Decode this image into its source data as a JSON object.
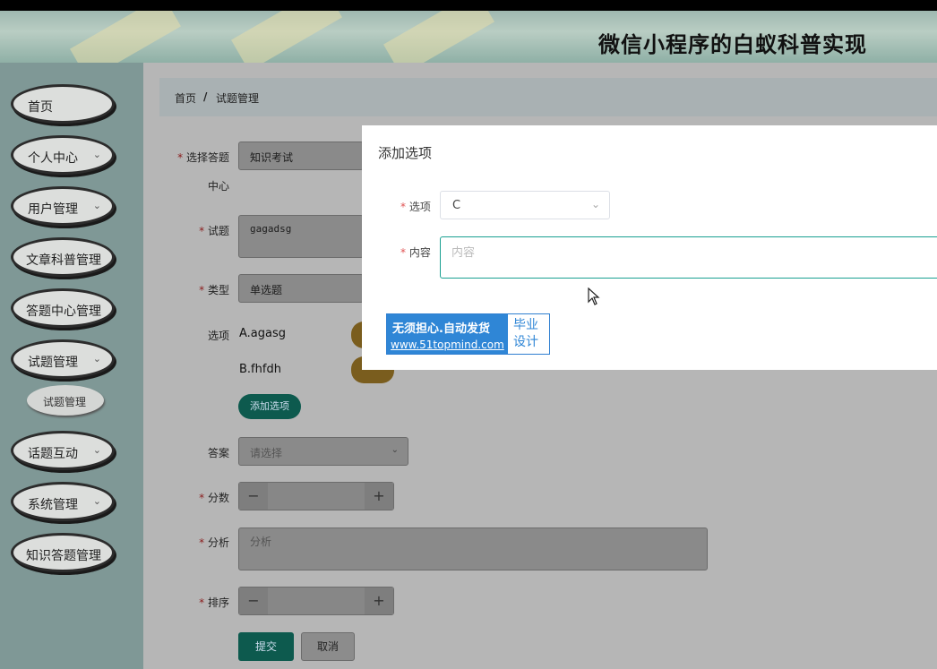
{
  "app_title": "微信小程序的白蚁科普实现",
  "sidebar": {
    "items": [
      {
        "label": "首页",
        "has_chevron": false
      },
      {
        "label": "个人中心",
        "has_chevron": true
      },
      {
        "label": "用户管理",
        "has_chevron": true
      },
      {
        "label": "文章科普管理",
        "has_chevron": false
      },
      {
        "label": "答题中心管理",
        "has_chevron": false
      },
      {
        "label": "试题管理",
        "has_chevron": true
      },
      {
        "label": "话题互动",
        "has_chevron": true
      },
      {
        "label": "系统管理",
        "has_chevron": true
      },
      {
        "label": "知识答题管理",
        "has_chevron": false
      }
    ],
    "sub_item": "试题管理"
  },
  "breadcrumb": {
    "home": "首页",
    "separator": "/",
    "current": "试题管理"
  },
  "form": {
    "center_label": "选择答题",
    "center_label_2": "中心",
    "center_value": "知识考试",
    "question_label": "试题",
    "question_value": "gagadsg",
    "type_label": "类型",
    "type_value": "单选题",
    "options_label": "选项",
    "options": [
      "A.agasg",
      "B.fhfdh"
    ],
    "add_option_button": "添加选项",
    "answer_label": "答案",
    "answer_placeholder": "请选择",
    "score_label": "分数",
    "analysis_label": "分析",
    "analysis_placeholder": "分析",
    "order_label": "排序",
    "minus": "−",
    "plus": "+",
    "submit_button": "提交",
    "cancel_button": "取消",
    "required_mark": "*"
  },
  "dialog": {
    "title": "添加选项",
    "option_label": "选项",
    "option_value": "C",
    "content_label": "内容",
    "content_placeholder": "内容"
  },
  "watermark": {
    "line1": "无须担心.自动发货",
    "line2": "www.51topmind.com",
    "right_line1": "毕业",
    "right_line2": "设计"
  },
  "icons": [
    "chevron-down-icon",
    "mouse-cursor-icon"
  ]
}
